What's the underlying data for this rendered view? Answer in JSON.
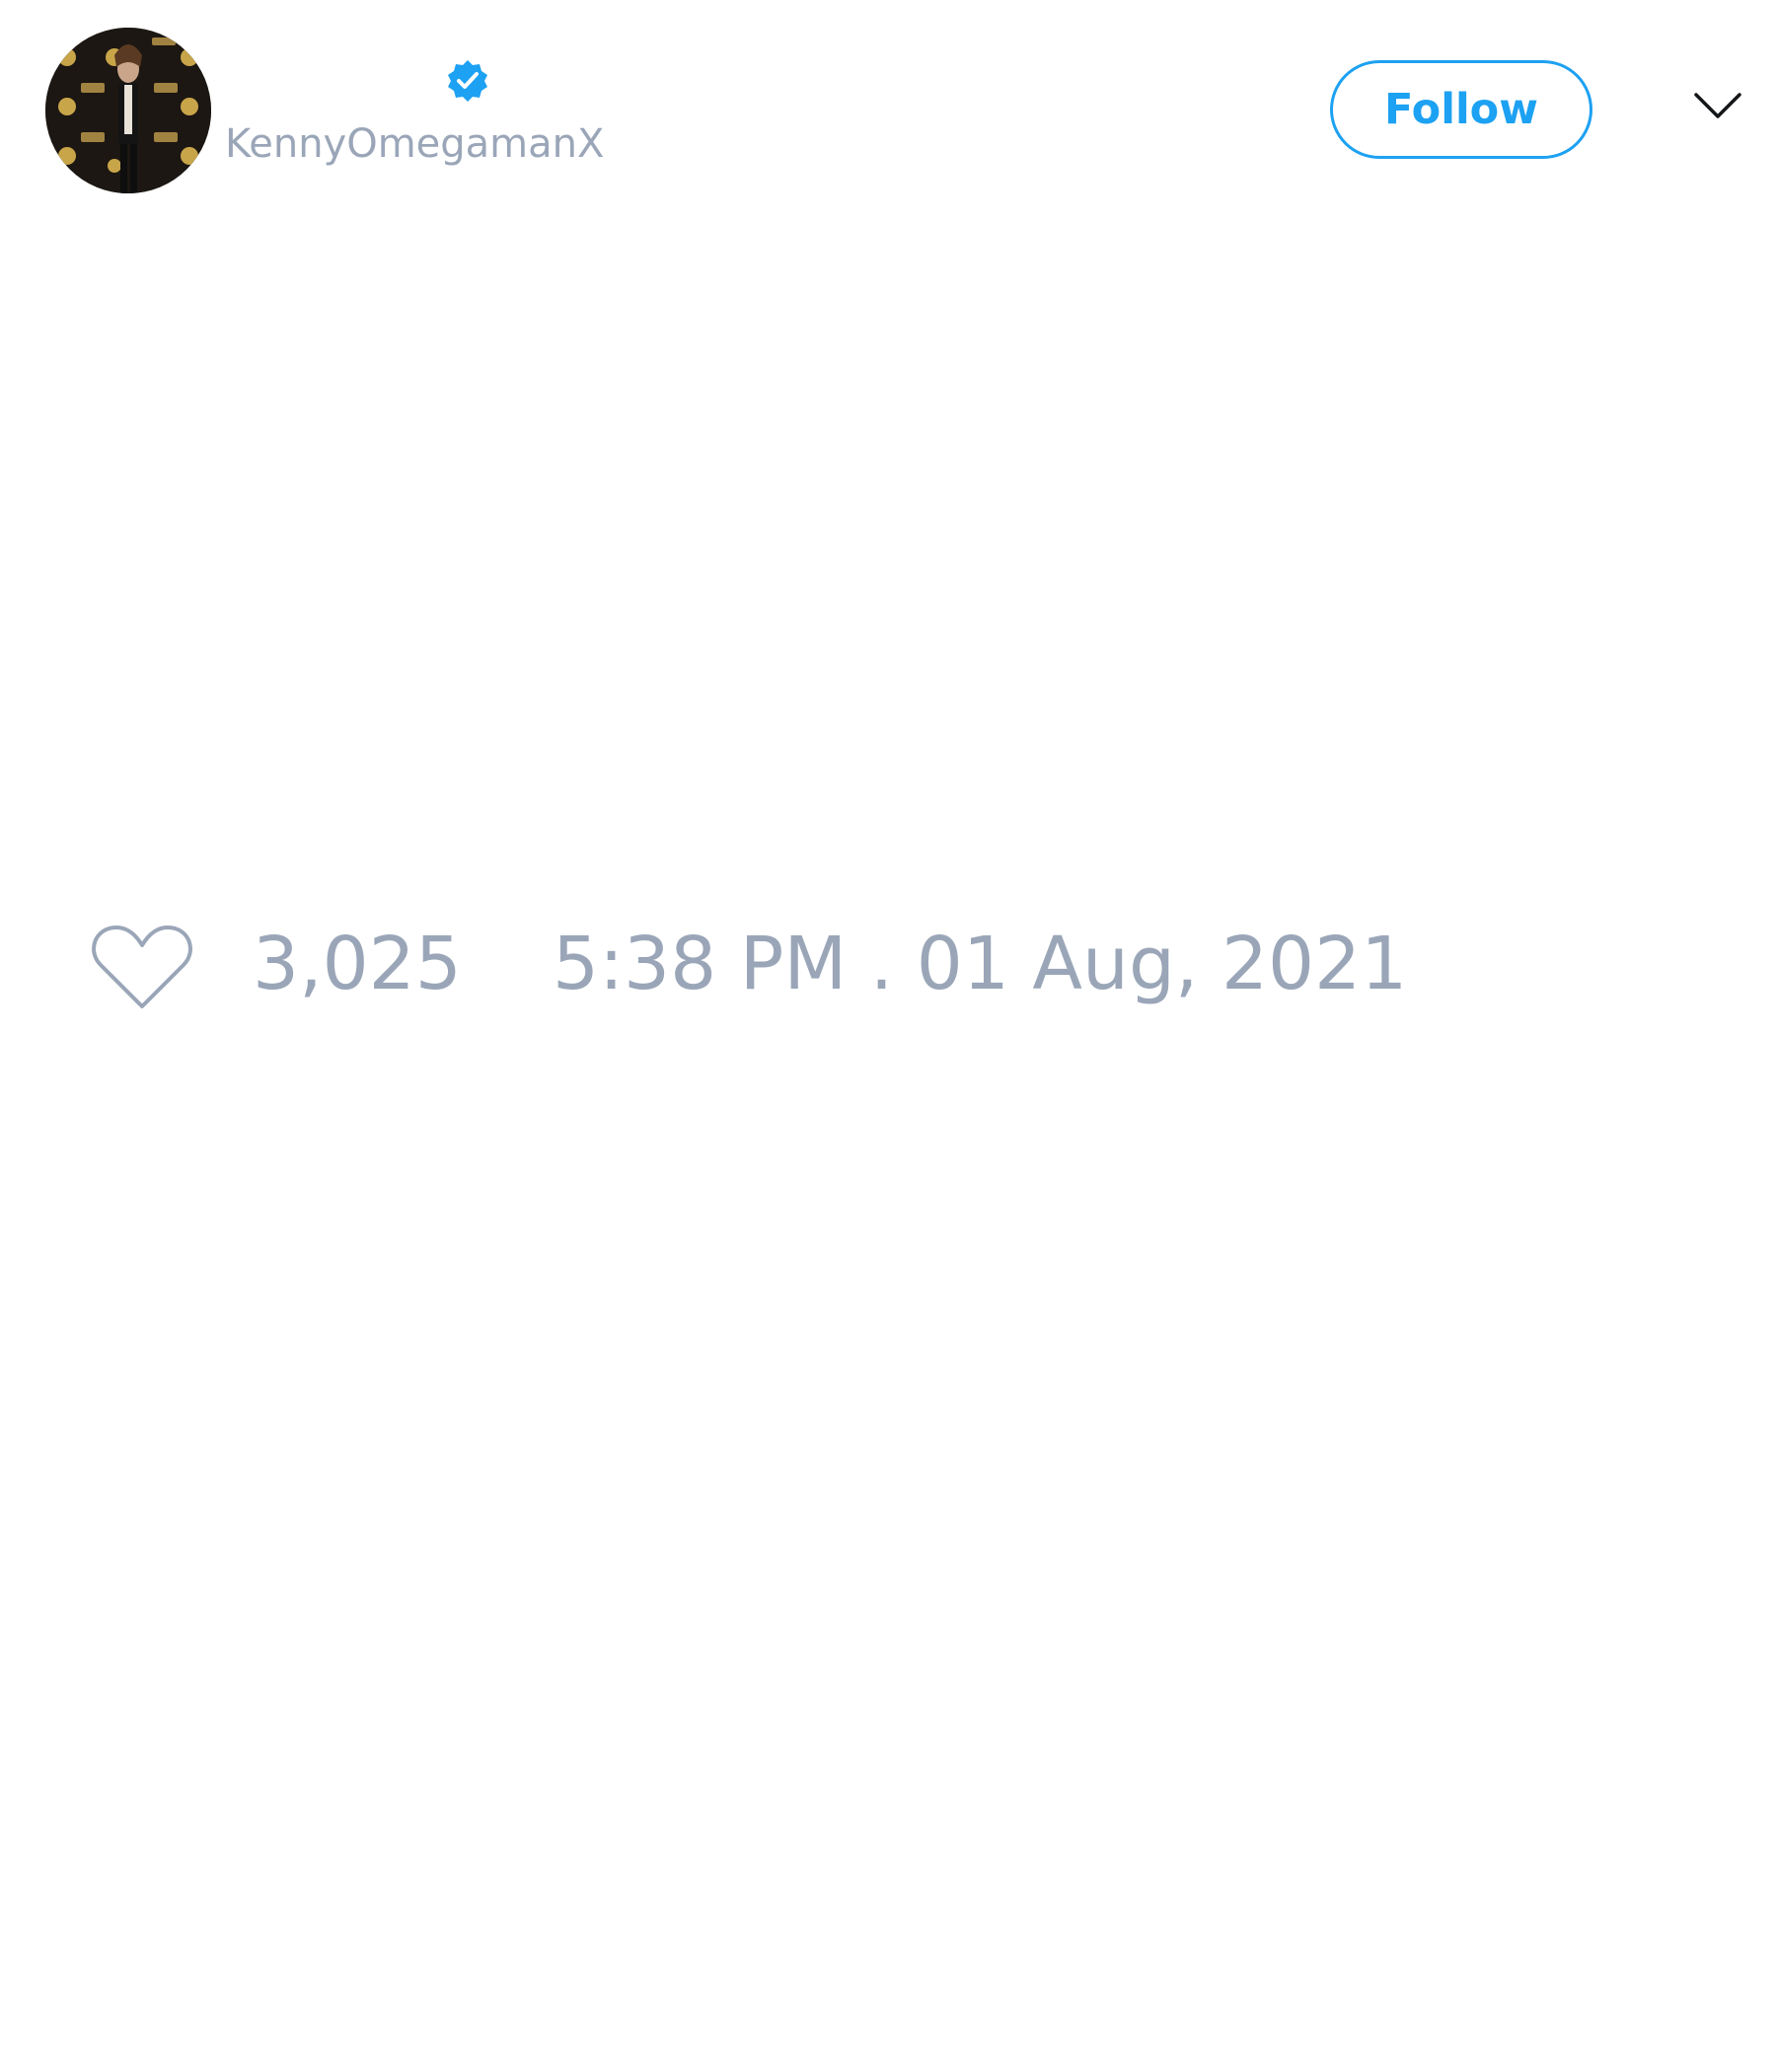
{
  "tweet": {
    "author": {
      "display_name": "",
      "handle": "KennyOmegamanX",
      "verified": true,
      "avatar_icon": "profile-photo"
    },
    "actions": {
      "follow_label": "Follow",
      "menu_icon": "chevron-down-icon"
    },
    "stats": {
      "like_icon": "heart-icon",
      "like_count": "3,025",
      "timestamp": "5:38 PM . 01 Aug, 2021"
    }
  },
  "colors": {
    "accent": "#1da1f2",
    "muted_text": "#9aa6b8",
    "background": "#ffffff"
  }
}
